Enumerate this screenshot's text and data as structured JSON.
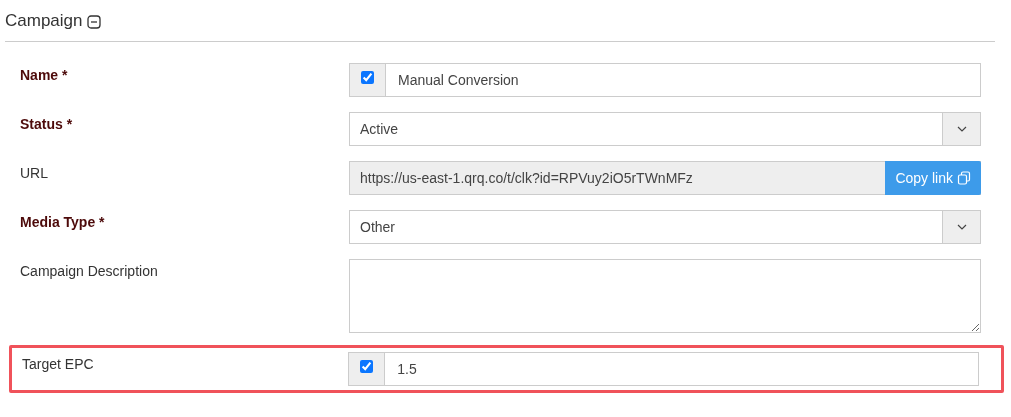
{
  "section": {
    "title": "Campaign",
    "expanded": true
  },
  "fields": [
    {
      "kind": "checkbox-text",
      "label": "Name *",
      "required": true,
      "checked": true,
      "value": "Manual Conversion",
      "highlighted": false
    },
    {
      "kind": "select",
      "label": "Status *",
      "required": true,
      "value": "Active",
      "highlighted": false
    },
    {
      "kind": "copy",
      "label": "URL",
      "required": false,
      "value": "https://us-east-1.qrq.co/t/clk?id=RPVuy2iO5rTWnMFz",
      "button": "Copy link",
      "highlighted": false
    },
    {
      "kind": "select",
      "label": "Media Type *",
      "required": true,
      "value": "Other",
      "highlighted": false
    },
    {
      "kind": "textarea",
      "label": "Campaign Description",
      "required": false,
      "highlighted": false
    },
    {
      "kind": "checkbox-text",
      "label": "Target EPC",
      "required": false,
      "checked": true,
      "value": "1.5",
      "highlighted": true
    }
  ]
}
